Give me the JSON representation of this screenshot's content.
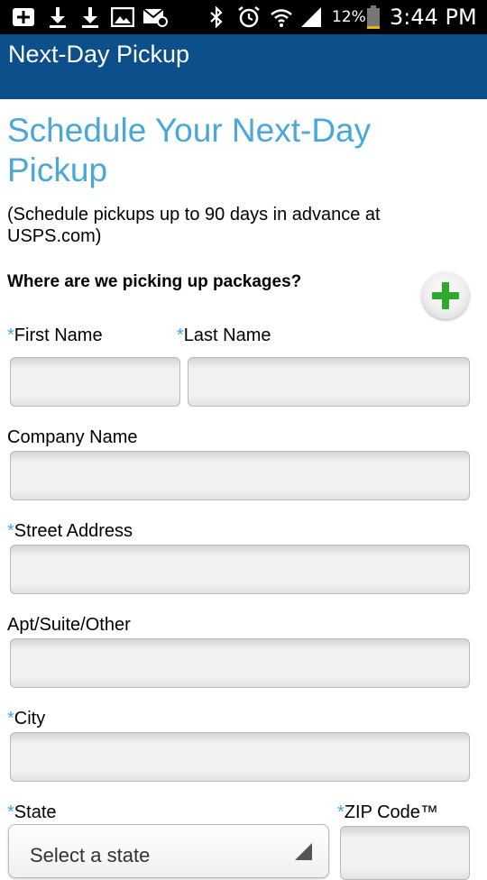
{
  "status_bar": {
    "battery_percent": "12%",
    "time": "3:44 PM",
    "icons": [
      "add-box-icon",
      "download-icon",
      "download-icon",
      "image-icon",
      "mail-icon",
      "bluetooth-icon",
      "alarm-icon",
      "wifi-icon",
      "signal-icon",
      "battery-icon"
    ],
    "battery_level": 0.12
  },
  "app_bar": {
    "title": "Next-Day Pickup"
  },
  "page": {
    "title": "Schedule Your Next-Day Pickup",
    "subtitle": "(Schedule pickups up to 90 days in advance at USPS.com)",
    "section_question": "Where are we picking up packages?"
  },
  "form": {
    "required_marker": "*",
    "first_name_label": "First Name",
    "last_name_label": "Last Name",
    "company_label": "Company Name",
    "street_label": "Street Address",
    "apt_label": "Apt/Suite/Other",
    "city_label": "City",
    "state_label": "State",
    "zip_label": "ZIP Code™",
    "state_select_value": "Select a state",
    "first_name_value": "",
    "last_name_value": "",
    "company_value": "",
    "street_value": "",
    "apt_value": "",
    "city_value": "",
    "zip_value": ""
  },
  "colors": {
    "app_bar": "#0d4f8b",
    "title": "#4aa7d8",
    "required_marker": "#4aa7d8",
    "add_icon": "#2fa82f"
  }
}
